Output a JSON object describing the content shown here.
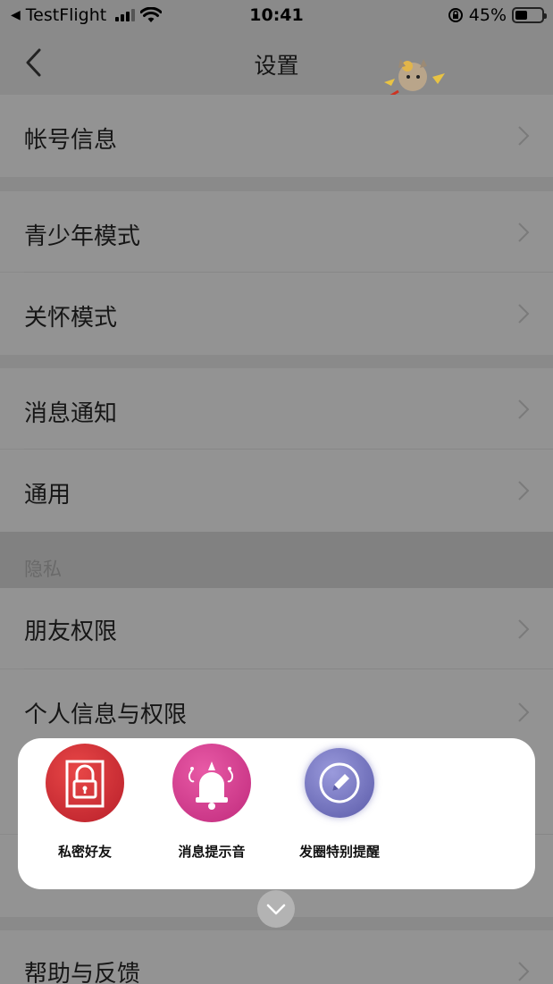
{
  "status_bar": {
    "carrier": "TestFlight",
    "back_arrow": "◀",
    "time": "10:41",
    "battery_percent": "45%",
    "battery_level": 0.45
  },
  "nav": {
    "title": "设置"
  },
  "rows": {
    "account": "帐号信息",
    "youth_mode": "青少年模式",
    "care_mode": "关怀模式",
    "notifications": "消息通知",
    "general": "通用",
    "friend_permissions": "朋友权限",
    "personal_info_permissions": "个人信息与权限",
    "help_feedback": "帮助与反馈"
  },
  "sections": {
    "privacy_header": "隐私"
  },
  "popup": {
    "items": [
      {
        "label": "私密好友",
        "icon": "lock-icon",
        "color": "#d42b2b"
      },
      {
        "label": "消息提示音",
        "icon": "bell-icon",
        "color": "#d83c8e"
      },
      {
        "label": "发圈特别提醒",
        "icon": "pencil-icon",
        "color": "#6a6ab8"
      }
    ]
  },
  "colors": {
    "overlay_background": "#939393",
    "popup_background": "#ffffff"
  }
}
